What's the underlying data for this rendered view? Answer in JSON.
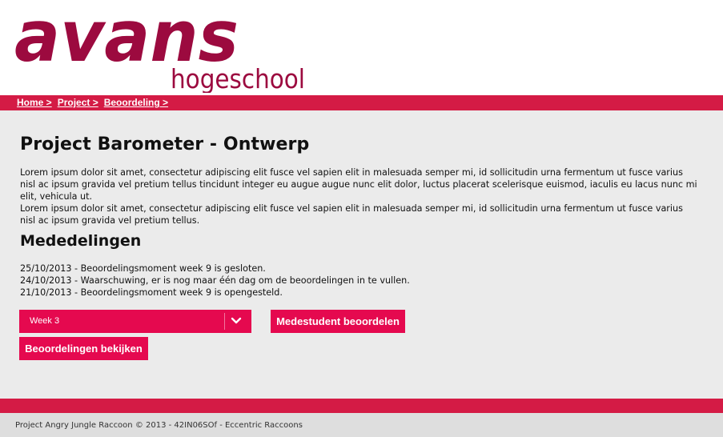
{
  "logo": {
    "word": "avans",
    "sub": "hogeschool"
  },
  "breadcrumb": [
    "Home >",
    "Project >",
    "Beoordeling >"
  ],
  "page_title": "Project Barometer - Ontwerp",
  "intro": [
    "Lorem ipsum dolor sit amet, consectetur adipiscing elit fusce vel sapien elit in malesuada semper mi, id sollicitudin urna fermentum ut fusce varius nisl ac ipsum gravida vel pretium tellus tincidunt integer eu augue augue nunc elit dolor, luctus placerat scelerisque euismod, iaculis eu lacus nunc mi elit, vehicula ut.",
    "Lorem ipsum dolor sit amet, consectetur adipiscing elit fusce vel sapien elit in malesuada semper mi, id sollicitudin urna fermentum ut fusce varius nisl ac ipsum gravida vel pretium tellus."
  ],
  "announcements": {
    "title": "Mededelingen",
    "items": [
      "25/10/2013 - Beoordelingsmoment week 9 is gesloten.",
      "24/10/2013 - Waarschuwing, er is nog maar één dag om de beoordelingen in te vullen.",
      "21/10/2013 - Beoordelingsmoment week 9 is opengesteld."
    ]
  },
  "week_select": {
    "value": "Week 3"
  },
  "buttons": {
    "peer_review": "Medestudent beoordelen",
    "view_reviews": "Beoordelingen bekijken"
  },
  "footer": "Project Angry Jungle Raccoon © 2013 - 42IN06SOf - Eccentric Raccoons",
  "colors": {
    "brand_red": "#d41b45",
    "button_pink": "#e5094f",
    "logo_maroon": "#9c0a3f"
  },
  "icons": {
    "select_toggle": "chevron-down-icon"
  }
}
